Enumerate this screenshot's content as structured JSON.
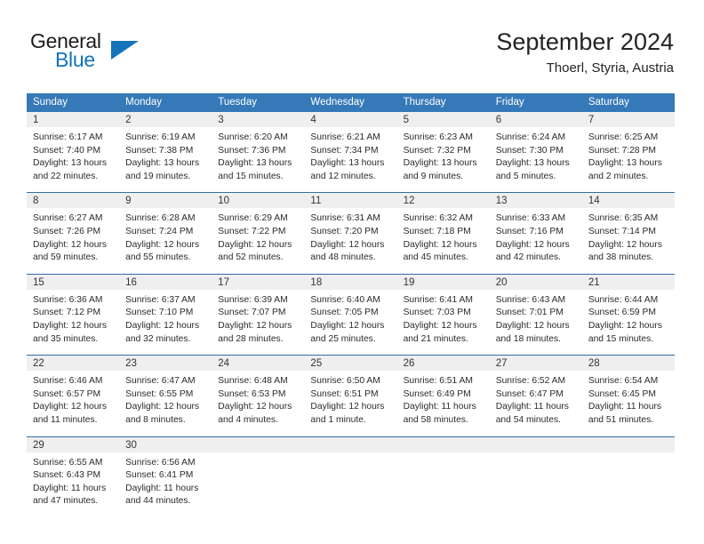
{
  "brand": {
    "name_top": "General",
    "name_bottom": "Blue",
    "triangle_color": "#1373bb",
    "text_color": "#1d1d1b"
  },
  "header": {
    "title": "September 2024",
    "subtitle": "Thoerl, Styria, Austria"
  },
  "theme": {
    "header_bg": "#3679b8",
    "header_text": "#ffffff",
    "row_separator": "#2f6ea8",
    "daynum_bg": "#efefef",
    "body_text": "#2b2b2b"
  },
  "weekdays": [
    "Sunday",
    "Monday",
    "Tuesday",
    "Wednesday",
    "Thursday",
    "Friday",
    "Saturday"
  ],
  "days": [
    {
      "date": "1",
      "sunrise": "Sunrise: 6:17 AM",
      "sunset": "Sunset: 7:40 PM",
      "daylight_line1": "Daylight: 13 hours",
      "daylight_line2": "and 22 minutes."
    },
    {
      "date": "2",
      "sunrise": "Sunrise: 6:19 AM",
      "sunset": "Sunset: 7:38 PM",
      "daylight_line1": "Daylight: 13 hours",
      "daylight_line2": "and 19 minutes."
    },
    {
      "date": "3",
      "sunrise": "Sunrise: 6:20 AM",
      "sunset": "Sunset: 7:36 PM",
      "daylight_line1": "Daylight: 13 hours",
      "daylight_line2": "and 15 minutes."
    },
    {
      "date": "4",
      "sunrise": "Sunrise: 6:21 AM",
      "sunset": "Sunset: 7:34 PM",
      "daylight_line1": "Daylight: 13 hours",
      "daylight_line2": "and 12 minutes."
    },
    {
      "date": "5",
      "sunrise": "Sunrise: 6:23 AM",
      "sunset": "Sunset: 7:32 PM",
      "daylight_line1": "Daylight: 13 hours",
      "daylight_line2": "and 9 minutes."
    },
    {
      "date": "6",
      "sunrise": "Sunrise: 6:24 AM",
      "sunset": "Sunset: 7:30 PM",
      "daylight_line1": "Daylight: 13 hours",
      "daylight_line2": "and 5 minutes."
    },
    {
      "date": "7",
      "sunrise": "Sunrise: 6:25 AM",
      "sunset": "Sunset: 7:28 PM",
      "daylight_line1": "Daylight: 13 hours",
      "daylight_line2": "and 2 minutes."
    },
    {
      "date": "8",
      "sunrise": "Sunrise: 6:27 AM",
      "sunset": "Sunset: 7:26 PM",
      "daylight_line1": "Daylight: 12 hours",
      "daylight_line2": "and 59 minutes."
    },
    {
      "date": "9",
      "sunrise": "Sunrise: 6:28 AM",
      "sunset": "Sunset: 7:24 PM",
      "daylight_line1": "Daylight: 12 hours",
      "daylight_line2": "and 55 minutes."
    },
    {
      "date": "10",
      "sunrise": "Sunrise: 6:29 AM",
      "sunset": "Sunset: 7:22 PM",
      "daylight_line1": "Daylight: 12 hours",
      "daylight_line2": "and 52 minutes."
    },
    {
      "date": "11",
      "sunrise": "Sunrise: 6:31 AM",
      "sunset": "Sunset: 7:20 PM",
      "daylight_line1": "Daylight: 12 hours",
      "daylight_line2": "and 48 minutes."
    },
    {
      "date": "12",
      "sunrise": "Sunrise: 6:32 AM",
      "sunset": "Sunset: 7:18 PM",
      "daylight_line1": "Daylight: 12 hours",
      "daylight_line2": "and 45 minutes."
    },
    {
      "date": "13",
      "sunrise": "Sunrise: 6:33 AM",
      "sunset": "Sunset: 7:16 PM",
      "daylight_line1": "Daylight: 12 hours",
      "daylight_line2": "and 42 minutes."
    },
    {
      "date": "14",
      "sunrise": "Sunrise: 6:35 AM",
      "sunset": "Sunset: 7:14 PM",
      "daylight_line1": "Daylight: 12 hours",
      "daylight_line2": "and 38 minutes."
    },
    {
      "date": "15",
      "sunrise": "Sunrise: 6:36 AM",
      "sunset": "Sunset: 7:12 PM",
      "daylight_line1": "Daylight: 12 hours",
      "daylight_line2": "and 35 minutes."
    },
    {
      "date": "16",
      "sunrise": "Sunrise: 6:37 AM",
      "sunset": "Sunset: 7:10 PM",
      "daylight_line1": "Daylight: 12 hours",
      "daylight_line2": "and 32 minutes."
    },
    {
      "date": "17",
      "sunrise": "Sunrise: 6:39 AM",
      "sunset": "Sunset: 7:07 PM",
      "daylight_line1": "Daylight: 12 hours",
      "daylight_line2": "and 28 minutes."
    },
    {
      "date": "18",
      "sunrise": "Sunrise: 6:40 AM",
      "sunset": "Sunset: 7:05 PM",
      "daylight_line1": "Daylight: 12 hours",
      "daylight_line2": "and 25 minutes."
    },
    {
      "date": "19",
      "sunrise": "Sunrise: 6:41 AM",
      "sunset": "Sunset: 7:03 PM",
      "daylight_line1": "Daylight: 12 hours",
      "daylight_line2": "and 21 minutes."
    },
    {
      "date": "20",
      "sunrise": "Sunrise: 6:43 AM",
      "sunset": "Sunset: 7:01 PM",
      "daylight_line1": "Daylight: 12 hours",
      "daylight_line2": "and 18 minutes."
    },
    {
      "date": "21",
      "sunrise": "Sunrise: 6:44 AM",
      "sunset": "Sunset: 6:59 PM",
      "daylight_line1": "Daylight: 12 hours",
      "daylight_line2": "and 15 minutes."
    },
    {
      "date": "22",
      "sunrise": "Sunrise: 6:46 AM",
      "sunset": "Sunset: 6:57 PM",
      "daylight_line1": "Daylight: 12 hours",
      "daylight_line2": "and 11 minutes."
    },
    {
      "date": "23",
      "sunrise": "Sunrise: 6:47 AM",
      "sunset": "Sunset: 6:55 PM",
      "daylight_line1": "Daylight: 12 hours",
      "daylight_line2": "and 8 minutes."
    },
    {
      "date": "24",
      "sunrise": "Sunrise: 6:48 AM",
      "sunset": "Sunset: 6:53 PM",
      "daylight_line1": "Daylight: 12 hours",
      "daylight_line2": "and 4 minutes."
    },
    {
      "date": "25",
      "sunrise": "Sunrise: 6:50 AM",
      "sunset": "Sunset: 6:51 PM",
      "daylight_line1": "Daylight: 12 hours",
      "daylight_line2": "and 1 minute."
    },
    {
      "date": "26",
      "sunrise": "Sunrise: 6:51 AM",
      "sunset": "Sunset: 6:49 PM",
      "daylight_line1": "Daylight: 11 hours",
      "daylight_line2": "and 58 minutes."
    },
    {
      "date": "27",
      "sunrise": "Sunrise: 6:52 AM",
      "sunset": "Sunset: 6:47 PM",
      "daylight_line1": "Daylight: 11 hours",
      "daylight_line2": "and 54 minutes."
    },
    {
      "date": "28",
      "sunrise": "Sunrise: 6:54 AM",
      "sunset": "Sunset: 6:45 PM",
      "daylight_line1": "Daylight: 11 hours",
      "daylight_line2": "and 51 minutes."
    },
    {
      "date": "29",
      "sunrise": "Sunrise: 6:55 AM",
      "sunset": "Sunset: 6:43 PM",
      "daylight_line1": "Daylight: 11 hours",
      "daylight_line2": "and 47 minutes."
    },
    {
      "date": "30",
      "sunrise": "Sunrise: 6:56 AM",
      "sunset": "Sunset: 6:41 PM",
      "daylight_line1": "Daylight: 11 hours",
      "daylight_line2": "and 44 minutes."
    }
  ],
  "grid": {
    "leading_blanks": 0,
    "trailing_blanks": 5
  }
}
